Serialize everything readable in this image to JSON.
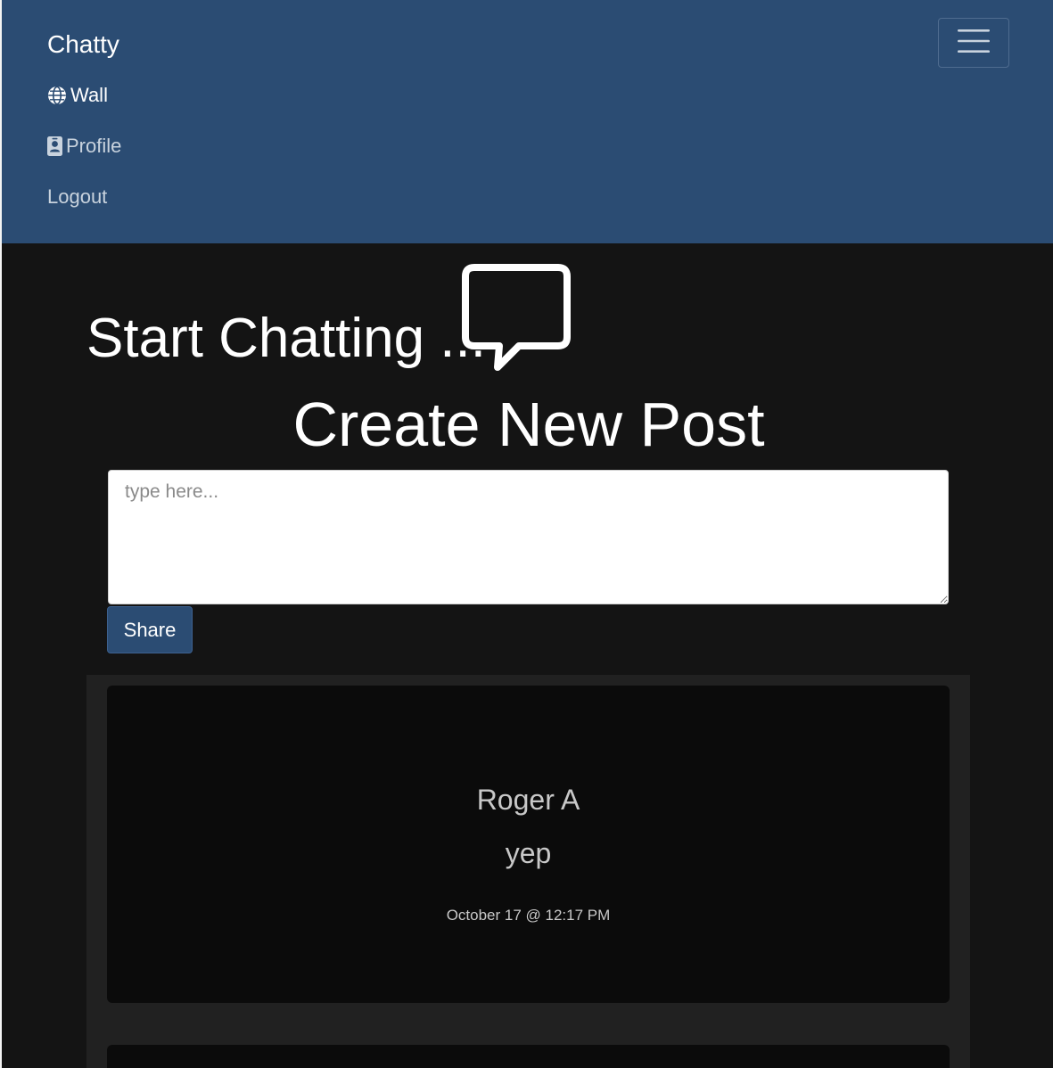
{
  "navbar": {
    "brand": "Chatty",
    "items": [
      {
        "label": "Wall",
        "icon": "globe-icon",
        "active": true
      },
      {
        "label": "Profile",
        "icon": "id-card-icon",
        "active": false
      },
      {
        "label": "Logout",
        "icon": "",
        "active": false
      }
    ],
    "toggle_icon": "hamburger-menu-icon"
  },
  "hero": {
    "title": "Start Chatting ...",
    "icon": "chat-bubble-icon"
  },
  "composer": {
    "heading": "Create New Post",
    "placeholder": "type here...",
    "value": "",
    "share_label": "Share"
  },
  "posts": [
    {
      "author": "Roger A",
      "body": "yep",
      "timestamp": "October 17 @ 12:17 PM"
    }
  ],
  "colors": {
    "navbar_bg": "#2b4c73",
    "page_bg": "#141414",
    "feed_bg": "#212121",
    "card_bg": "#0b0b0b",
    "primary_button": "#2b4c73"
  }
}
